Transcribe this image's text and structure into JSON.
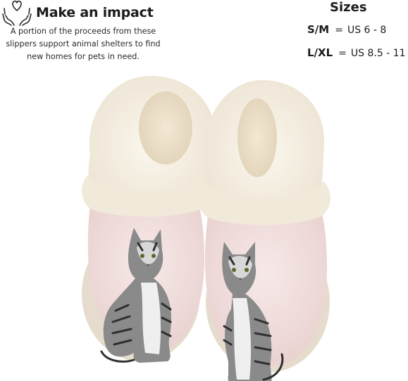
{
  "impact": {
    "icon": "hands-heart-icon",
    "title": "Make an impact",
    "text": "A portion of the proceeds from these slippers support animal shelters to find new homes for pets in need."
  },
  "sizes": {
    "title": "Sizes",
    "rows": [
      {
        "label": "S/M",
        "eq": "=",
        "value": "US 6 - 8"
      },
      {
        "label": "L/XL",
        "eq": "=",
        "value": "US 8.5 - 11"
      }
    ]
  },
  "colors": {
    "slipper_body": "#f1dede",
    "fur": "#f6f0e2",
    "sole": "#e9dfd1",
    "text": "#1c1c1c"
  }
}
